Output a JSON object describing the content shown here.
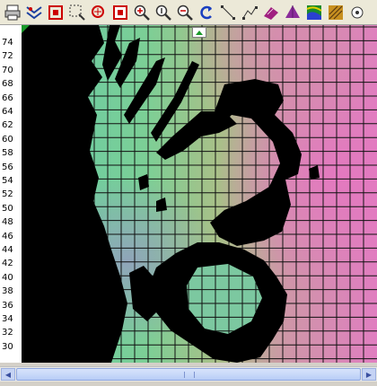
{
  "toolbar": {
    "icons": [
      "print-icon",
      "layers-icon",
      "zoom-extent-icon",
      "zoom-box-icon",
      "zoom-area-icon",
      "zoom-region-icon",
      "zoom-in-icon",
      "zoom-realtime-icon",
      "zoom-out-icon",
      "redraw-icon",
      "line-tool-icon",
      "polyline-tool-icon",
      "surface-map-icon",
      "3d-surface-icon",
      "contour-color-icon",
      "shaded-relief-icon",
      "base-map-icon"
    ]
  },
  "y_axis": {
    "ticks": [
      "74",
      "72",
      "70",
      "68",
      "66",
      "64",
      "62",
      "60",
      "58",
      "56",
      "54",
      "52",
      "50",
      "48",
      "46",
      "44",
      "42",
      "40",
      "38",
      "36",
      "34",
      "32",
      "30"
    ]
  },
  "colors": {
    "land_mask": "#000000",
    "surface_low": "#6ed1a6",
    "surface_mid": "#8fc98c",
    "surface_high": "#d88ab8",
    "grid_line": "#111111"
  }
}
